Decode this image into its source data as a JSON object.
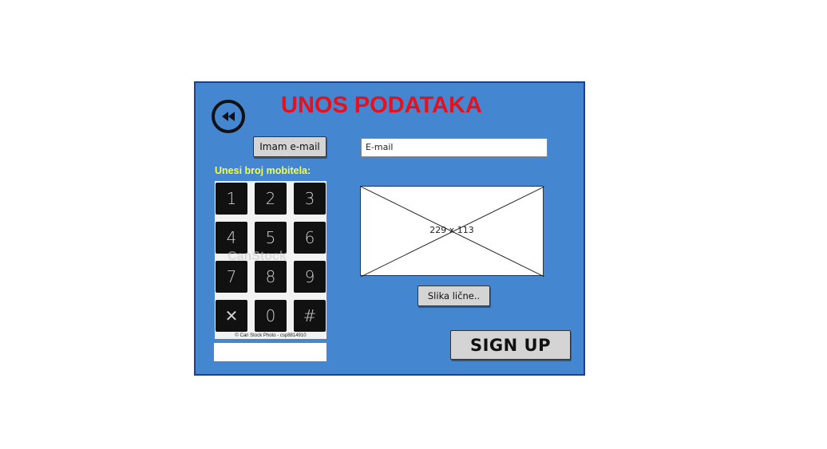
{
  "title": "UNOS PODATAKA",
  "back_icon": "rewind-icon",
  "email_button_label": "Imam e-mail",
  "email_field_value": "E-mail",
  "mobile_label": "Unesi broj mobitela:",
  "keypad": {
    "keys": [
      "1",
      "2",
      "3",
      "4",
      "5",
      "6",
      "7",
      "8",
      "9",
      "✕",
      "0",
      "#"
    ],
    "watermark": "CanStock",
    "credit": "© Can Stock Photo - csp8814910"
  },
  "image_placeholder_size": "229 x 113",
  "photo_button_label": "Slika lične..",
  "signup_button_label": "SIGN UP",
  "colors": {
    "panel_bg": "#4586d0",
    "title": "#e8101a",
    "label": "#f4ff4a",
    "button_bg": "#d4d4d4"
  }
}
